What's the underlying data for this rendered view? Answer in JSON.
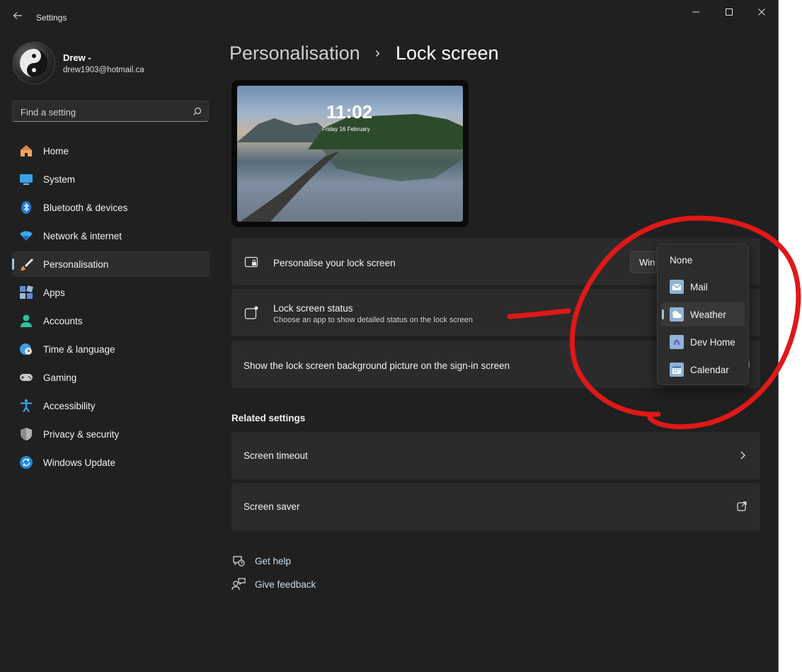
{
  "window": {
    "title": "Settings"
  },
  "user": {
    "name": "Drew -",
    "email": "drew1903@hotmail.ca"
  },
  "search": {
    "placeholder": "Find a setting"
  },
  "nav": [
    {
      "label": "Home",
      "icon": "home-icon"
    },
    {
      "label": "System",
      "icon": "system-icon"
    },
    {
      "label": "Bluetooth & devices",
      "icon": "bluetooth-icon"
    },
    {
      "label": "Network & internet",
      "icon": "network-icon"
    },
    {
      "label": "Personalisation",
      "icon": "brush-icon",
      "active": true
    },
    {
      "label": "Apps",
      "icon": "apps-icon"
    },
    {
      "label": "Accounts",
      "icon": "accounts-icon"
    },
    {
      "label": "Time & language",
      "icon": "time-language-icon"
    },
    {
      "label": "Gaming",
      "icon": "gaming-icon"
    },
    {
      "label": "Accessibility",
      "icon": "accessibility-icon"
    },
    {
      "label": "Privacy & security",
      "icon": "shield-icon"
    },
    {
      "label": "Windows Update",
      "icon": "windows-update-icon"
    }
  ],
  "breadcrumb": {
    "parent": "Personalisation",
    "separator": "›",
    "current": "Lock screen"
  },
  "preview": {
    "time": "11:02",
    "date": "Friday 16 February"
  },
  "cards": {
    "personalise": {
      "title": "Personalise your lock screen",
      "value": "Win"
    },
    "status": {
      "title": "Lock screen status",
      "subtitle": "Choose an app to show detailed status on the lock screen"
    },
    "signin": {
      "title": "Show the lock screen background picture on the sign-in screen"
    }
  },
  "related": {
    "heading": "Related settings",
    "items": [
      {
        "label": "Screen timeout"
      },
      {
        "label": "Screen saver"
      }
    ]
  },
  "help": {
    "get_help": "Get help",
    "feedback": "Give feedback"
  },
  "dropdown": {
    "options": [
      {
        "label": "None",
        "icon": ""
      },
      {
        "label": "Mail",
        "icon": "mail-icon"
      },
      {
        "label": "Weather",
        "icon": "weather-icon",
        "selected": true
      },
      {
        "label": "Dev Home",
        "icon": "dev-home-icon"
      },
      {
        "label": "Calendar",
        "icon": "calendar-icon"
      }
    ]
  },
  "colors": {
    "accent": "#a8c0d8",
    "annotation": "#e01818",
    "background": "#202020",
    "card": "#2b2b2b"
  }
}
